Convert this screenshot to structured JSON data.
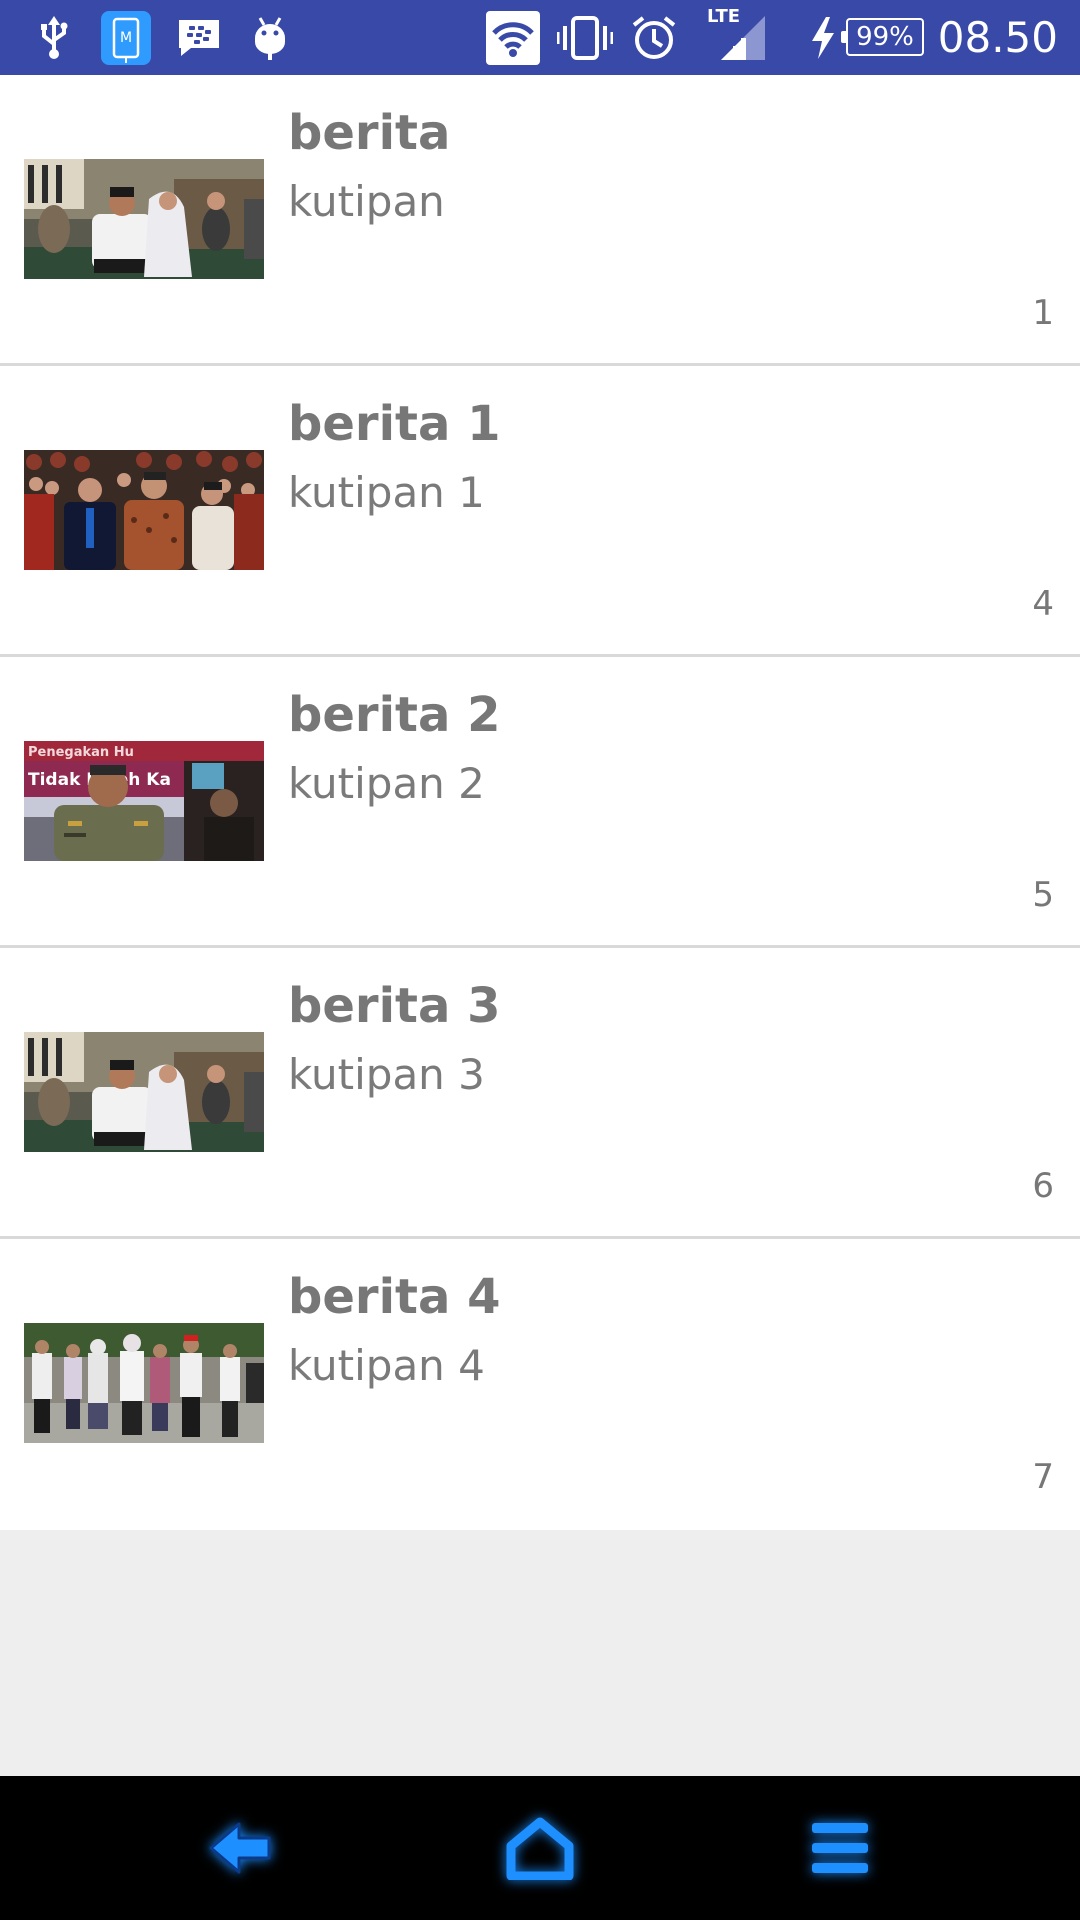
{
  "status_bar": {
    "time": "08.50",
    "battery": "99%",
    "network": "LTE",
    "icons": [
      "usb-icon",
      "m-app-icon",
      "bbm-icon",
      "android-debug-icon",
      "wifi-icon",
      "vibrate-icon",
      "alarm-icon",
      "signal-icon",
      "charging-icon"
    ],
    "background": "#3949a8"
  },
  "news": [
    {
      "title": "berita",
      "quote": "kutipan",
      "count": "1",
      "thumb": "couple-photo"
    },
    {
      "title": "berita 1",
      "quote": "kutipan 1",
      "count": "4",
      "thumb": "crowd-photo"
    },
    {
      "title": "berita 2",
      "quote": "kutipan 2",
      "count": "5",
      "thumb": "police-photo"
    },
    {
      "title": "berita 3",
      "quote": "kutipan 3",
      "count": "6",
      "thumb": "couple-photo"
    },
    {
      "title": "berita 4",
      "quote": "kutipan 4",
      "count": "7",
      "thumb": "walking-group-photo"
    }
  ],
  "thumb_banner_text": "Penegakan Hu... Tidak Boleh Ka...",
  "nav_bar": {
    "buttons": [
      "back-icon",
      "home-icon",
      "menu-icon"
    ],
    "accent": "#1a8cff"
  }
}
